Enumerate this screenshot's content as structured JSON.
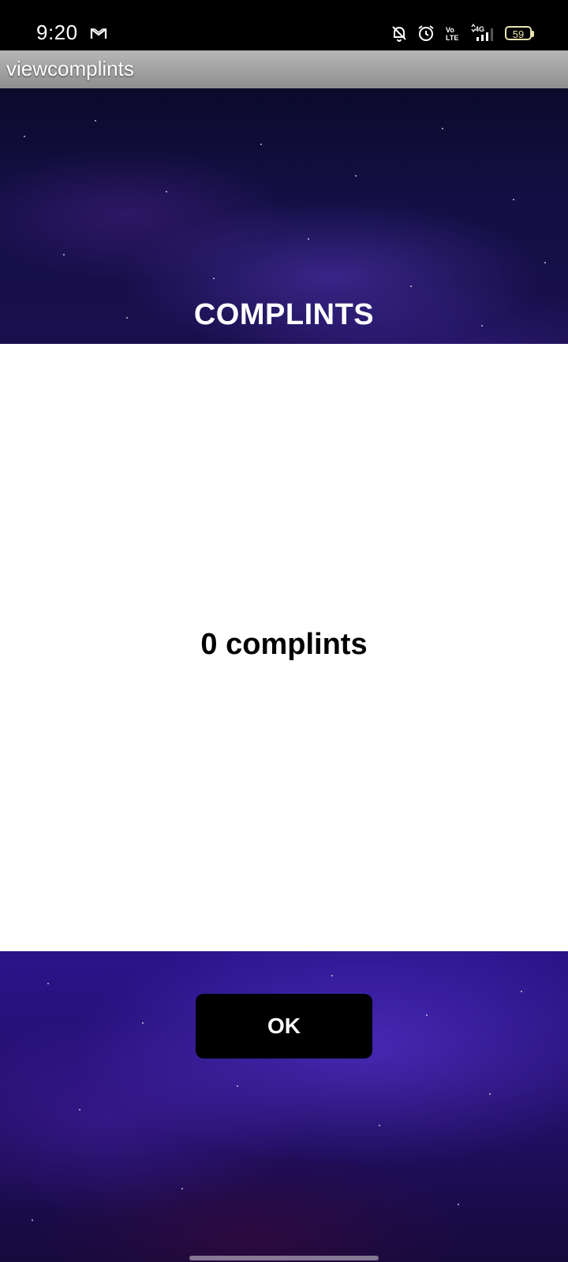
{
  "status_bar": {
    "time": "9:20",
    "battery_level": "59",
    "icons": [
      "gmail-icon",
      "notifications-off-icon",
      "alarm-icon",
      "volte-icon",
      "signal-4g-icon",
      "battery-icon"
    ]
  },
  "app_bar": {
    "title": "viewcomplints"
  },
  "header": {
    "title": "COMPLINTS"
  },
  "content": {
    "count_text": "0 complints"
  },
  "actions": {
    "ok_label": "OK"
  },
  "colors": {
    "status_bar": "#000000",
    "app_bar": "#9e9e9e",
    "content_bg": "#ffffff",
    "button_bg": "#000000",
    "button_text": "#ffffff"
  }
}
